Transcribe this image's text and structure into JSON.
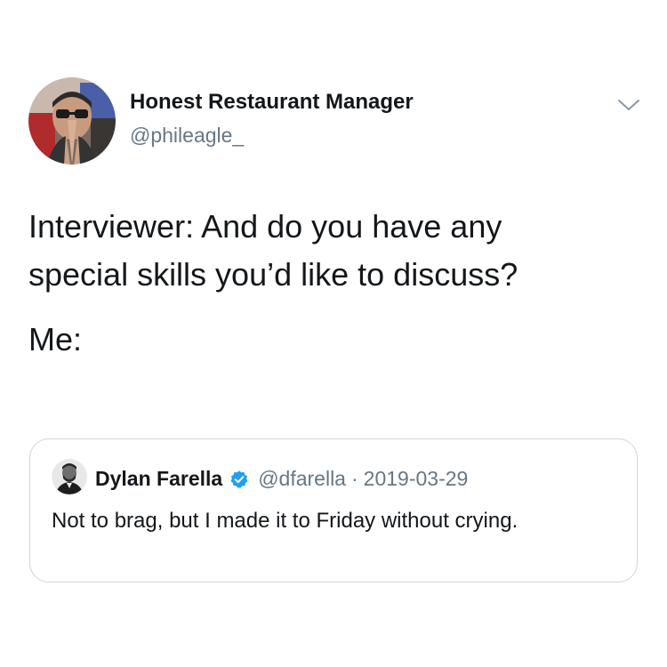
{
  "tweet": {
    "author": {
      "name": "Honest Restaurant Manager",
      "handle": "@phileagle_",
      "avatar_icon": "avatar-man-praying-hands"
    },
    "menu_icon": "chevron-down-icon",
    "text_lines": [
      "Interviewer: And do you have any",
      "special skills you’d like to discuss?",
      "Me:"
    ]
  },
  "quoted_tweet": {
    "author": {
      "name": "Dylan Farella",
      "handle": "@dfarella",
      "separator": "·",
      "date": "2019-03-29",
      "verified_icon": "verified-badge-icon",
      "avatar_icon": "avatar-man-bw"
    },
    "text": "Not to brag, but I made it to Friday without crying."
  },
  "colors": {
    "primary_text": "#14171a",
    "secondary_text": "#657786",
    "verified_blue": "#1da1f2",
    "border": "#ccd6dd"
  }
}
